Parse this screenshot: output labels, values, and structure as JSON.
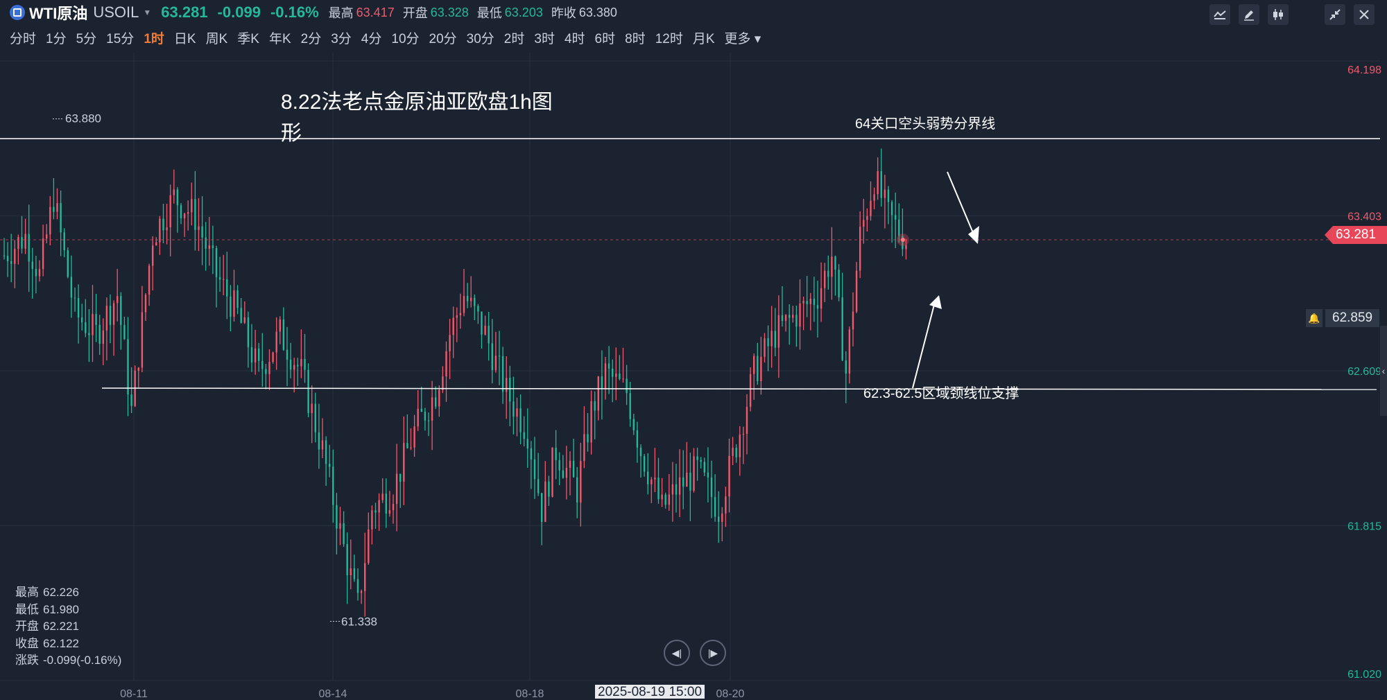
{
  "header": {
    "symbol_name": "WTI原油",
    "symbol_code": "USOIL",
    "last_price": "63.281",
    "change": "-0.099",
    "change_pct": "-0.16%",
    "high_label": "最高",
    "high": "63.417",
    "open_label": "开盘",
    "open": "63.328",
    "low_label": "最低",
    "low": "63.203",
    "prev_close_label": "昨收",
    "prev_close": "63.380"
  },
  "periods": [
    "分时",
    "1分",
    "5分",
    "15分",
    "1时",
    "日K",
    "周K",
    "季K",
    "年K",
    "2分",
    "3分",
    "4分",
    "10分",
    "20分",
    "30分",
    "2时",
    "3时",
    "4时",
    "6时",
    "8时",
    "12时",
    "月K",
    "更多"
  ],
  "active_period": "1时",
  "toolbar_icons": [
    "indicator-icon",
    "draw-pen-icon",
    "candle-style-icon",
    "collapse-icon",
    "close-icon"
  ],
  "colors": {
    "up": "#f05a6b",
    "down": "#26b89a",
    "background": "#1b2230",
    "annotation": "#ffffff",
    "last_tag": "#e8475a"
  },
  "ohlc_readout": {
    "rows": [
      {
        "label": "最高",
        "value": "62.226"
      },
      {
        "label": "最低",
        "value": "61.980"
      },
      {
        "label": "开盘",
        "value": "62.221"
      },
      {
        "label": "收盘",
        "value": "62.122"
      },
      {
        "label": "涨跌",
        "value": "-0.099(-0.16%)"
      }
    ]
  },
  "price_tags": {
    "last": "63.281",
    "alert": "62.859"
  },
  "crosshair_time": "2025-08-19 15:00",
  "chart_data": {
    "type": "candlestick",
    "title": "8.22法老点金原油亚欧盘1h图形",
    "y_axis": {
      "ticks": [
        "64.198",
        "63.403",
        "62.609",
        "61.815",
        "61.020"
      ],
      "tick_colors": [
        "#f05a6b",
        "#f05a6b",
        "#26b89a",
        "#26b89a",
        "#26b89a"
      ],
      "ylim": [
        61.02,
        64.198
      ]
    },
    "x_axis": {
      "ticks": [
        "08-11",
        "08-14",
        "08-18",
        "08-20"
      ]
    },
    "bars_count": 170,
    "high_marker": {
      "price": 63.88,
      "label": "63.880"
    },
    "low_marker": {
      "price": 61.338,
      "label": "61.338"
    },
    "last_price_line": 63.281,
    "resistance_line": {
      "price": 63.8,
      "label": "64关口空头弱势分界线"
    },
    "support_line": {
      "price": 62.52,
      "label": "62.3-62.5区域颈线位支撑"
    },
    "grid": true
  }
}
